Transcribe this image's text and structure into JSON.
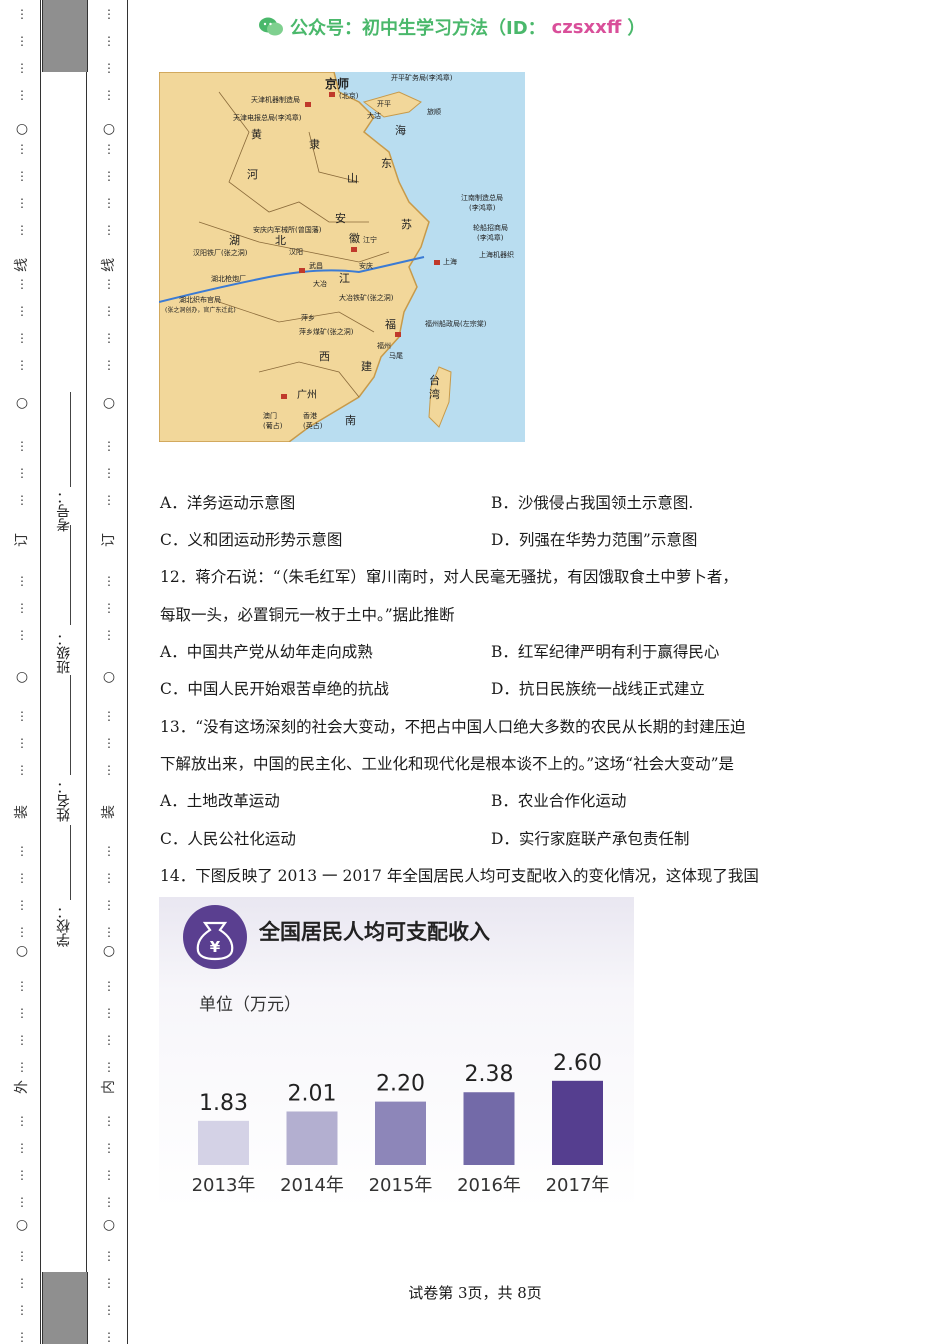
{
  "margin": {
    "outer_marks": [
      "线",
      "订",
      "装",
      "外"
    ],
    "inner_marks": [
      "线",
      "订",
      "装",
      "内"
    ],
    "fields": {
      "exam_no": "考号：",
      "class": "班级：",
      "name": "姓名：",
      "school": "学校："
    }
  },
  "watermark": {
    "text": "公众号：初中生学习方法（ID：",
    "id": "czsxxff",
    "close": "）"
  },
  "map": {
    "labels": [
      "京师",
      "(北京)",
      "开平矿务局(李鸿章)",
      "天津机器制造局",
      "天津电报总局(李鸿章)",
      "大沽",
      "开平",
      "旅顺",
      "黄",
      "隶",
      "河",
      "山",
      "东",
      "海",
      "江南制造总局",
      "(李鸿章)",
      "轮船招商局",
      "(李鸿章)",
      "上海机器织",
      "上海",
      "安庆内军械所(曾国藩)",
      "汉阳铁厂(张之洞)",
      "湖北枪炮厂",
      "湖北织布官局",
      "(张之洞创办，官广东迁此)",
      "汉阳",
      "武昌",
      "大冶",
      "安庆",
      "江宁",
      "大冶铁矿(张之洞)",
      "萍乡",
      "萍乡煤矿(张之洞)",
      "福州船政局(左宗棠)",
      "福州",
      "马尾",
      "广州",
      "澳门",
      "(葡占)",
      "香港",
      "(英占)",
      "台",
      "湾",
      "南",
      "湖",
      "北",
      "江",
      "西",
      "建",
      "苏",
      "安",
      "徽",
      "福"
    ]
  },
  "questions": {
    "q11_opts": {
      "A": "A．洋务运动示意图",
      "B": "B．沙俄侵占我国领土示意图.",
      "C": "C．义和团运动形势示意图",
      "D": "D．列强在华势力范围”示意图"
    },
    "q12": {
      "line1": "12．蒋介石说：“（朱毛红军）窜川南时，对人民毫无骚扰，有因饿取食土中萝卜者，",
      "line2": "每取一头，必置铜元一枚于土中。”据此推断",
      "A": "A．中国共产党从幼年走向成熟",
      "B": "B．红军纪律严明有利于赢得民心",
      "C": "C．中国人民开始艰苦卓绝的抗战",
      "D": "D．抗日民族统一战线正式建立"
    },
    "q13": {
      "line1": "13．“没有这场深刻的社会大变动，不把占中国人口绝大多数的农民从长期的封建压迫",
      "line2": "下解放出来，中国的民主化、工业化和现代化是根本谈不上的。”这场“社会大变动”是",
      "A": "A．土地改革运动",
      "B": "B．农业合作化运动",
      "C": "C．人民公社化运动",
      "D": "D．实行家庭联产承包责任制"
    },
    "q14": {
      "line1": "14．下图反映了 2013 一 2017 年全国居民人均可支配收入的变化情况，这体现了我国"
    }
  },
  "chart_data": {
    "type": "bar",
    "title": "全国居民人均可支配收入",
    "ylabel": "单位（万元）",
    "categories": [
      "2013年",
      "2014年",
      "2015年",
      "2016年",
      "2017年"
    ],
    "values": [
      1.83,
      2.01,
      2.2,
      2.38,
      2.6
    ],
    "value_labels": [
      "1.83",
      "2.01",
      "2.20",
      "2.38",
      "2.60"
    ],
    "colors": [
      "#d4d2e6",
      "#b3afd0",
      "#8d86b9",
      "#736aa8",
      "#553e8f"
    ],
    "icon": "money-bag-icon",
    "icon_symbol": "¥"
  },
  "footer": {
    "text": "试卷第 3页，共 8页"
  }
}
